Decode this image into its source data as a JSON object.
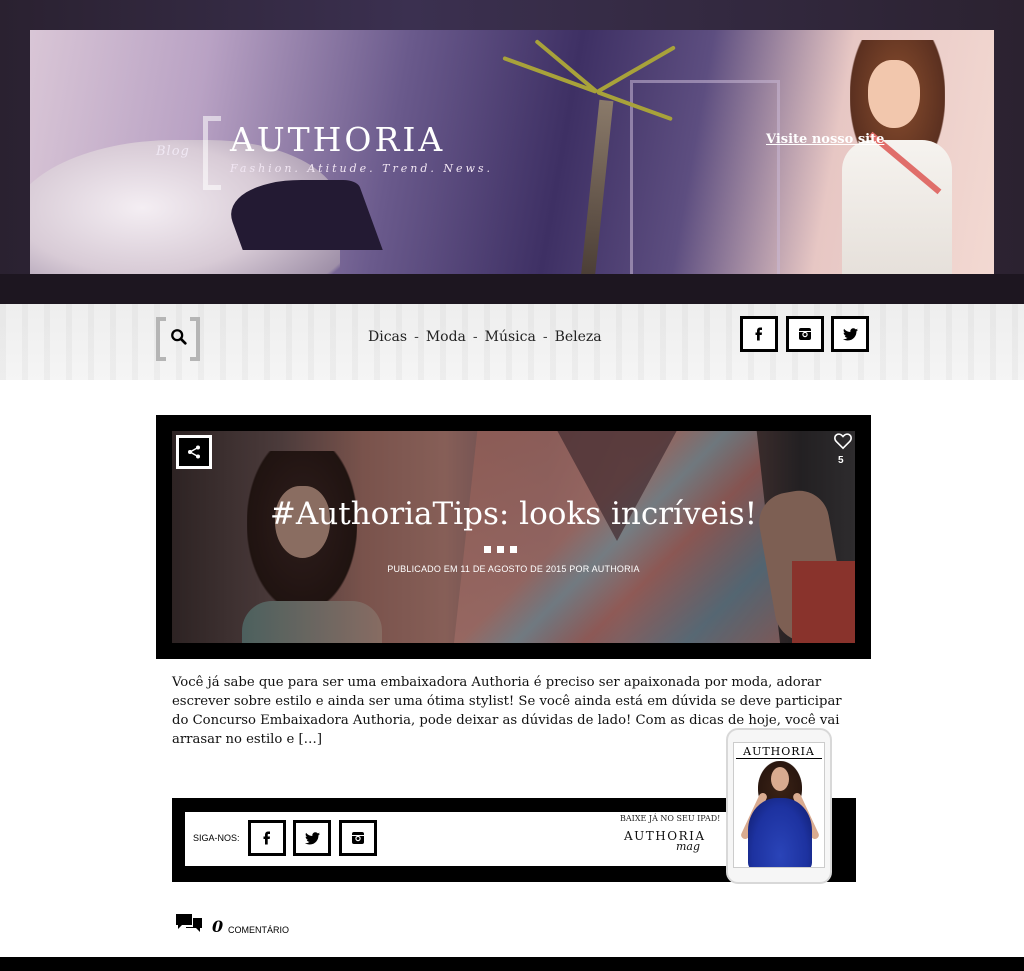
{
  "header": {
    "blog_tag": "Blog",
    "title": "AUTHORIA",
    "subtitle": "Fashion. Atitude. Trend. News.",
    "visit_link": "Visite nosso site"
  },
  "nav": {
    "search_icon": "search-icon",
    "items": [
      {
        "label": "Dicas"
      },
      {
        "label": "Moda"
      },
      {
        "label": "Música"
      },
      {
        "label": "Beleza"
      }
    ],
    "separator": "-",
    "social": [
      "facebook-icon",
      "instagram-icon",
      "twitter-icon"
    ]
  },
  "post": {
    "title": "#AuthoriaTips: looks incríveis!",
    "meta": "PUBLICADO EM 11 DE AGOSTO DE 2015 POR AUTHORIA",
    "likes": "5",
    "excerpt": "Você já sabe que para ser uma embaixadora Authoria é preciso ser apaixonada por moda, adorar escrever sobre estilo e ainda ser uma ótima stylist! Se você ainda está em dúvida se deve participar do Concurso Embaixadora Authoria, pode deixar as dúvidas de lado! Com as dicas de hoje, você vai arrasar no estilo e […]"
  },
  "follow": {
    "label": "SIGA-NOS:",
    "ipad_text": "BAIXE JÁ NO SEU IPAD!",
    "ipad_brand": "AUTHORIA",
    "ipad_script": "mag",
    "tablet_brand": "AUTHORIA"
  },
  "comments": {
    "count": "0",
    "label": "COMENTÁRIO"
  },
  "colors": {
    "accent": "#000000",
    "background": "#ffffff",
    "nav_bg": "#efefef"
  }
}
